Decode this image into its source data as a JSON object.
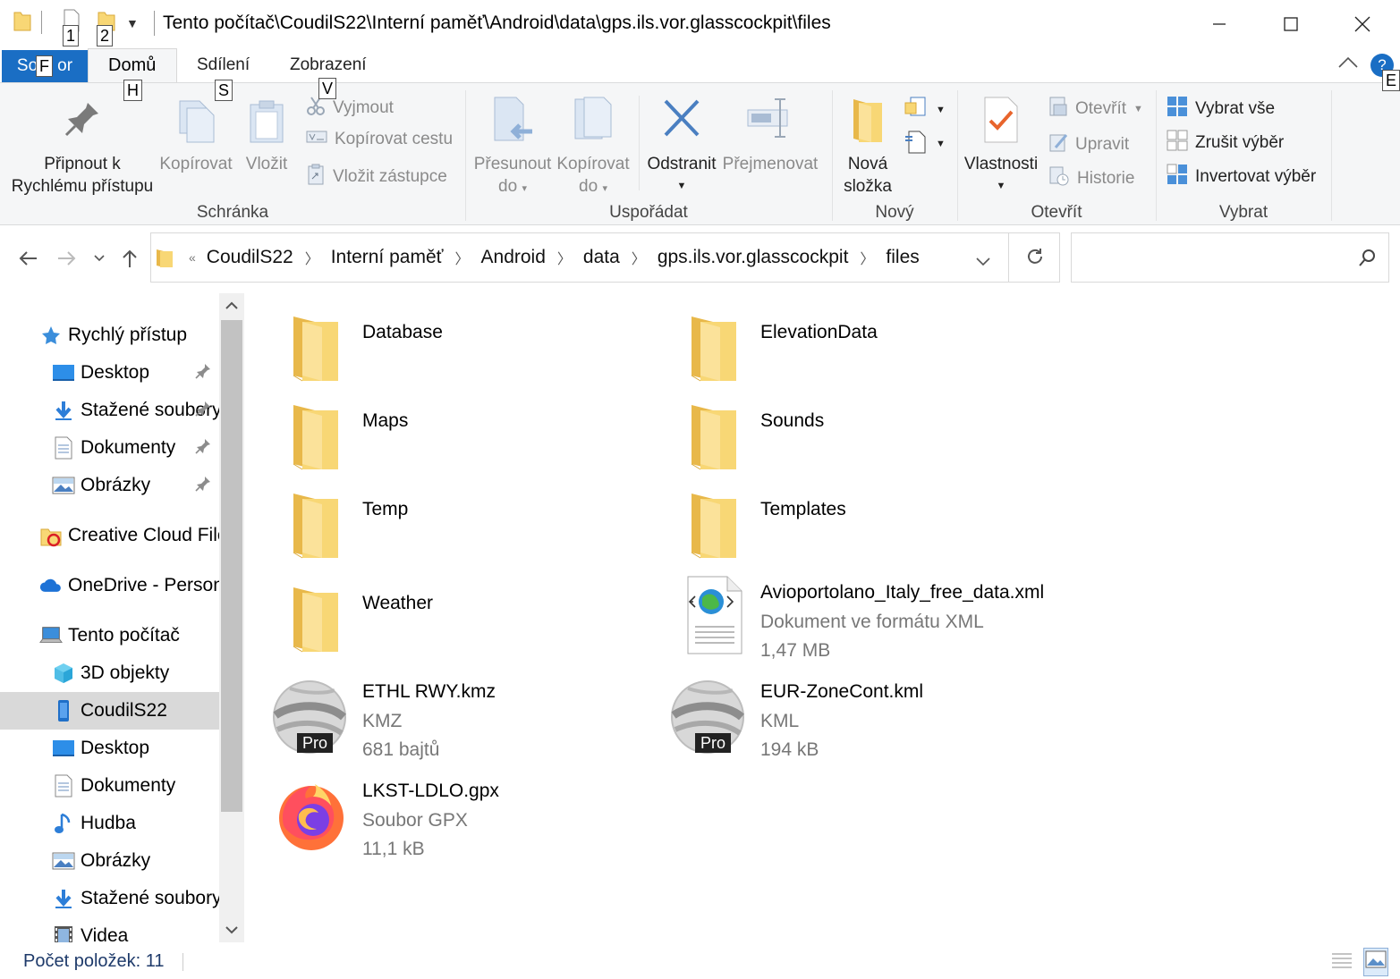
{
  "window": {
    "title": "Tento počítač\\CoudilS22\\Interní paměť\\Android\\data\\gps.ils.vor.glasscockpit\\files",
    "minimize": "—",
    "maximize": "☐",
    "close": "✕"
  },
  "keytips": {
    "qa1": "1",
    "qa2": "2",
    "file": "F",
    "home": "H",
    "share": "S",
    "view": "V",
    "help": "E"
  },
  "tabs": {
    "file": "Soubor",
    "file_visible": "So",
    "file_visible_end": "or",
    "home": "Domů",
    "share": "Sdílení",
    "view": "Zobrazení",
    "help": "?"
  },
  "ribbon": {
    "clipboard": {
      "label": "Schránka",
      "pin": "Připnout k Rychlému přístupu",
      "pin_line1": "Připnout k",
      "pin_line2": "Rychlému přístupu",
      "copy": "Kopírovat",
      "paste": "Vložit",
      "cut": "Vyjmout",
      "copy_path": "Kopírovat cestu",
      "paste_shortcut": "Vložit zástupce"
    },
    "organize": {
      "label": "Uspořádat",
      "move_to_1": "Přesunout",
      "move_to_2": "do",
      "copy_to_1": "Kopírovat",
      "copy_to_2": "do",
      "delete": "Odstranit",
      "rename": "Přejmenovat"
    },
    "new": {
      "label": "Nový",
      "new_folder_1": "Nová",
      "new_folder_2": "složka"
    },
    "open": {
      "label": "Otevřít",
      "properties": "Vlastnosti",
      "open": "Otevřít",
      "edit": "Upravit",
      "history": "Historie"
    },
    "select": {
      "label": "Vybrat",
      "select_all": "Vybrat vše",
      "select_none": "Zrušit výběr",
      "invert": "Invertovat výběr"
    }
  },
  "address": {
    "overflow": "«",
    "crumbs": [
      "CoudilS22",
      "Interní paměť",
      "Android",
      "data",
      "gps.ils.vor.glasscockpit",
      "files"
    ],
    "search_placeholder": ""
  },
  "nav": {
    "items": [
      {
        "label": "Rychlý přístup",
        "icon": "star-icon",
        "indent": 0
      },
      {
        "label": "Desktop",
        "icon": "desktop-icon",
        "indent": 1,
        "pinned": true
      },
      {
        "label": "Stažené soubory",
        "icon": "download-icon",
        "indent": 1,
        "pinned": true
      },
      {
        "label": "Dokumenty",
        "icon": "documents-icon",
        "indent": 1,
        "pinned": true
      },
      {
        "label": "Obrázky",
        "icon": "pictures-icon",
        "indent": 1,
        "pinned": true
      },
      {
        "label": "Creative Cloud Files",
        "icon": "creative-cloud-icon",
        "indent": 0
      },
      {
        "label": "OneDrive - Personal",
        "icon": "onedrive-icon",
        "indent": 0
      },
      {
        "label": "Tento počítač",
        "icon": "this-pc-icon",
        "indent": 0
      },
      {
        "label": "3D objekty",
        "icon": "3d-objects-icon",
        "indent": 1
      },
      {
        "label": "CoudilS22",
        "icon": "phone-icon",
        "indent": 1,
        "selected": true
      },
      {
        "label": "Desktop",
        "icon": "desktop-icon",
        "indent": 1
      },
      {
        "label": "Dokumenty",
        "icon": "documents-icon",
        "indent": 1
      },
      {
        "label": "Hudba",
        "icon": "music-icon",
        "indent": 1
      },
      {
        "label": "Obrázky",
        "icon": "pictures-icon",
        "indent": 1
      },
      {
        "label": "Stažené soubory",
        "icon": "download-icon",
        "indent": 1
      },
      {
        "label": "Videa",
        "icon": "videos-icon",
        "indent": 1
      }
    ]
  },
  "files": [
    {
      "name": "Database",
      "kind": "folder"
    },
    {
      "name": "ElevationData",
      "kind": "folder"
    },
    {
      "name": "Maps",
      "kind": "folder"
    },
    {
      "name": "Sounds",
      "kind": "folder"
    },
    {
      "name": "Temp",
      "kind": "folder"
    },
    {
      "name": "Templates",
      "kind": "folder"
    },
    {
      "name": "Weather",
      "kind": "folder"
    },
    {
      "name": "Avioportolano_Italy_free_data.xml",
      "kind": "xml",
      "type": "Dokument ve formátu XML",
      "size": "1,47 MB"
    },
    {
      "name": "ETHL RWY.kmz",
      "kind": "earth",
      "type": "KMZ",
      "size": "681 bajtů",
      "badge": "Pro"
    },
    {
      "name": "EUR-ZoneCont.kml",
      "kind": "earth",
      "type": "KML",
      "size": "194 kB",
      "badge": "Pro"
    },
    {
      "name": "LKST-LDLO.gpx",
      "kind": "firefox",
      "type": "Soubor GPX",
      "size": "11,1 kB"
    }
  ],
  "status": {
    "count": "Počet položek: 11"
  },
  "colors": {
    "accent": "#1a6ec4",
    "folder": "#f8d775",
    "folder_dark": "#e8b84a",
    "selection": "#d9d9d9"
  }
}
